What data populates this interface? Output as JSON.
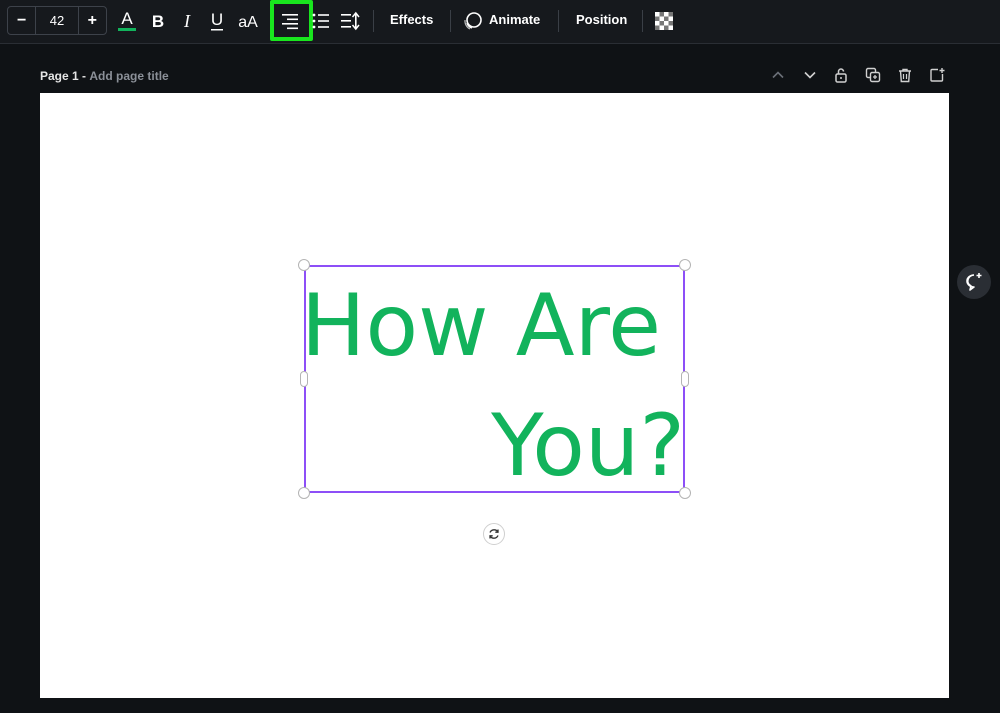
{
  "toolbar": {
    "font_size": "42",
    "decrease_label": "−",
    "increase_label": "+",
    "effects_label": "Effects",
    "animate_label": "Animate",
    "position_label": "Position",
    "text_color": "#12b35c",
    "highlight_color": "#19e61e",
    "icons": [
      "text-color-icon",
      "bold-icon",
      "italic-icon",
      "underline-icon",
      "letter-case-icon",
      "align-right-icon",
      "list-icon",
      "spacing-icon",
      "animate-icon",
      "transparency-icon"
    ]
  },
  "page": {
    "name": "Page 1 -",
    "title_placeholder": "Add page title"
  },
  "canvas": {
    "text_line1": "How Are",
    "text_line2": "You?",
    "text_color": "#12b35c",
    "selection_color": "#8d4ff7"
  }
}
